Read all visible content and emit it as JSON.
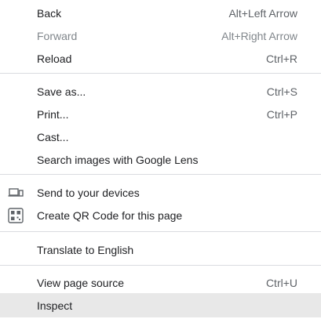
{
  "menu": {
    "back": {
      "label": "Back",
      "shortcut": "Alt+Left Arrow"
    },
    "forward": {
      "label": "Forward",
      "shortcut": "Alt+Right Arrow"
    },
    "reload": {
      "label": "Reload",
      "shortcut": "Ctrl+R"
    },
    "save_as": {
      "label": "Save as...",
      "shortcut": "Ctrl+S"
    },
    "print": {
      "label": "Print...",
      "shortcut": "Ctrl+P"
    },
    "cast": {
      "label": "Cast..."
    },
    "search_lens": {
      "label": "Search images with Google Lens"
    },
    "send_devices": {
      "label": "Send to your devices",
      "icon": "devices-icon"
    },
    "qr_code": {
      "label": "Create QR Code for this page",
      "icon": "qr-code-icon"
    },
    "translate": {
      "label": "Translate to English"
    },
    "view_source": {
      "label": "View page source",
      "shortcut": "Ctrl+U"
    },
    "inspect": {
      "label": "Inspect"
    }
  },
  "colors": {
    "text": "#202124",
    "disabled_text": "#80868b",
    "separator": "#dadce0",
    "hover_background": "#e8e8e8"
  }
}
